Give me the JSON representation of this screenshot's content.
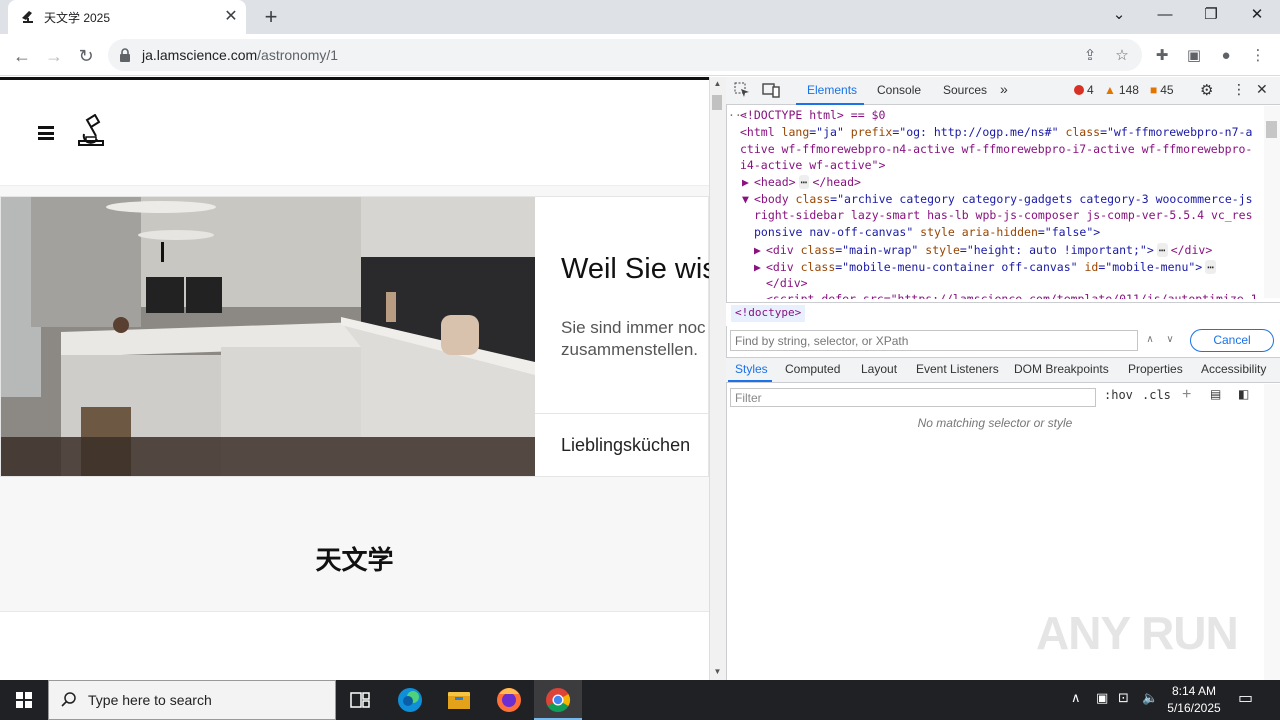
{
  "browser": {
    "tab_title": "天文学 2025",
    "url_domain": "ja.lamscience.com",
    "url_path": "/astronomy/1"
  },
  "page": {
    "hero_heading": "Weil Sie wis",
    "hero_text": "Sie sind immer noc zusammenstellen.",
    "hero_link": "Lieblingsküchen",
    "section_title": "天文学"
  },
  "devtools": {
    "tabs": [
      "Elements",
      "Console",
      "Sources"
    ],
    "errors": "4",
    "warnings": "148",
    "issues": "45",
    "code_lines": {
      "l1": "<!DOCTYPE html> == $0",
      "l2a": "<html ",
      "l2b": "lang",
      "l2c": "=\"ja\" ",
      "l2d": "prefix",
      "l2e": "=\"og: http://ogp.me/ns#\" ",
      "l2f": "class",
      "l2g": "=\"wf-ffmorewebpro-n7-a",
      "l3": "ctive wf-ffmorewebpro-n4-active wf-ffmorewebpro-i7-active wf-ffmorewebpro-",
      "l4": "i4-active wf-active\">",
      "l5": "<head>",
      "l5b": "</head>",
      "l6a": "<body ",
      "l6b": "class",
      "l6c": "=\"archive category category-gadgets category-3 woocommerce-js",
      "l7": "right-sidebar lazy-smart has-lb wpb-js-composer js-comp-ver-5.5.4 vc_res",
      "l8a": "ponsive nav-off-canvas\" ",
      "l8b": "style aria-hidden",
      "l8c": "=\"false\">",
      "l9a": "<div ",
      "l9b": "class",
      "l9c": "=\"main-wrap\" ",
      "l9d": "style",
      "l9e": "=\"height: auto !important;\">",
      "l9f": "</div>",
      "l10a": "<div ",
      "l10b": "class",
      "l10c": "=\"mobile-menu-container off-canvas\" ",
      "l10d": "id",
      "l10e": "=\"mobile-menu\">",
      "l11": "</div>",
      "l12": "<script defer src=\"https://lamscience.com/template/011/js/autoptimize_1"
    },
    "breadcrumb": "<!doctype>",
    "find_placeholder": "Find by string, selector, or XPath",
    "cancel_label": "Cancel",
    "subtabs": [
      "Styles",
      "Computed",
      "Layout",
      "Event Listeners",
      "DOM Breakpoints",
      "Properties",
      "Accessibility"
    ],
    "filter_placeholder": "Filter",
    "hov_label": ":hov",
    "cls_label": ".cls",
    "no_match": "No matching selector or style"
  },
  "watermark": "ANY RUN",
  "taskbar": {
    "search_placeholder": "Type here to search",
    "time": "8:14 AM",
    "date": "5/16/2025"
  },
  "colors": {
    "accent": "#1a73e8",
    "taskbar": "#202124"
  }
}
